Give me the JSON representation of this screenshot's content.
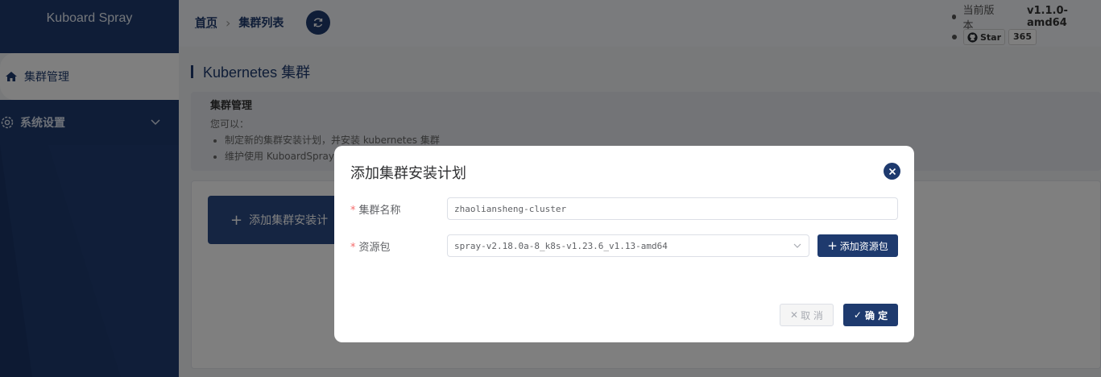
{
  "sidebar": {
    "brand": "Kuboard Spray",
    "items": [
      {
        "label": "集群管理",
        "icon": "home-icon",
        "active": true
      },
      {
        "label": "系统设置",
        "icon": "gear-icon",
        "active": false
      }
    ]
  },
  "breadcrumb": {
    "home": "首页",
    "current": "集群列表"
  },
  "header": {
    "version_label": "当前版本",
    "version_value": "v1.1.0-amd64",
    "star_label": "Star",
    "star_count": "365"
  },
  "main": {
    "title": "Kubernetes 集群",
    "tip_heading": "集群管理",
    "tip_intro": "您可以：",
    "tip_items": [
      "制定新的集群安装计划，并安装 kubernetes 集群",
      "维护使用 KuboardSpray 安"
    ],
    "add_card_label": "添加集群安装计"
  },
  "dialog": {
    "title": "添加集群安装计划",
    "fields": {
      "cluster_name_label": "集群名称",
      "cluster_name_value": "zhaoliansheng-cluster",
      "resource_label": "资源包",
      "resource_value": "spray-v2.18.0a-8_k8s-v1.23.6_v1.13-amd64"
    },
    "add_resource_label": "添加资源包",
    "cancel_label": "取 消",
    "confirm_label": "确 定"
  },
  "colors": {
    "primary": "#1e3a6e",
    "required": "#f56c6c"
  }
}
